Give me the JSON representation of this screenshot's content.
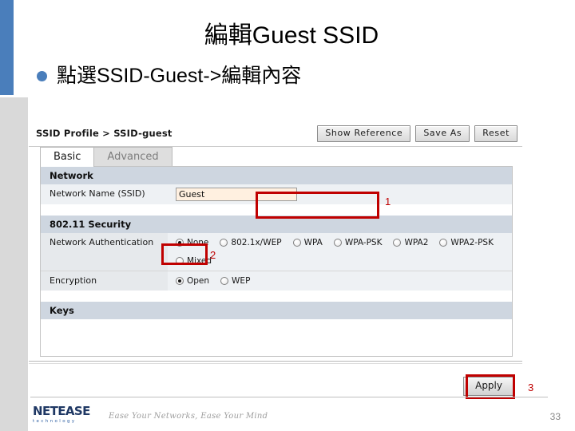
{
  "slide": {
    "title": "編輯Guest SSID",
    "bullet": "點選SSID-Guest->編輯內容",
    "page_number": "33",
    "accent_blue": "#4a7ebb",
    "annotation_red": "#c00000"
  },
  "router_ui": {
    "breadcrumb": "SSID Profile > SSID-guest",
    "toolbar": {
      "show_reference_label": "Show Reference",
      "save_as_label": "Save As",
      "reset_label": "Reset"
    },
    "tabs": [
      {
        "label": "Basic",
        "active": true
      },
      {
        "label": "Advanced",
        "active": false
      }
    ],
    "sections": [
      {
        "header": "Network",
        "rows": [
          {
            "label": "Network Name (SSID)",
            "type": "text",
            "value": "Guest"
          }
        ]
      },
      {
        "header": "802.11 Security",
        "rows": [
          {
            "label": "Network Authentication",
            "type": "radio",
            "options": [
              {
                "label": "None",
                "checked": true
              },
              {
                "label": "802.1x/WEP",
                "checked": false
              },
              {
                "label": "WPA",
                "checked": false
              },
              {
                "label": "WPA-PSK",
                "checked": false
              },
              {
                "label": "WPA2",
                "checked": false
              },
              {
                "label": "WPA2-PSK",
                "checked": false
              }
            ],
            "options_row2": [
              {
                "label": "Mixed",
                "checked": false
              }
            ]
          },
          {
            "label": "Encryption",
            "type": "radio",
            "options": [
              {
                "label": "Open",
                "checked": true
              },
              {
                "label": "WEP",
                "checked": false
              }
            ]
          }
        ]
      },
      {
        "header": "Keys",
        "rows": []
      }
    ],
    "apply_label": "Apply"
  },
  "annotations": [
    {
      "number": "1",
      "target": "ssid-text-input"
    },
    {
      "number": "2",
      "target": "security-none-radio"
    },
    {
      "number": "3",
      "target": "apply-button"
    }
  ],
  "footer": {
    "logo_text": "NETEASE",
    "logo_sub": "technology",
    "tagline": "Ease Your Networks, Ease Your Mind"
  }
}
